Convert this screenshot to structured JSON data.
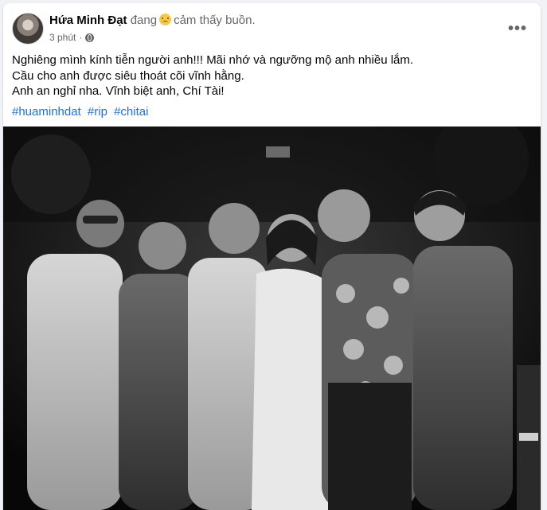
{
  "post": {
    "author": "Hứa Minh Đạt",
    "feeling_prefix": "đang",
    "feeling_emoji": "sad-face-icon",
    "feeling_text": "cảm thấy buồn.",
    "timestamp": "3 phút",
    "separator": "·",
    "privacy_icon": "globe-icon",
    "more_icon": "more-options-icon",
    "more_label": "•••",
    "lines": [
      "Nghiêng mình kính tiễn người anh!!! Mãi nhớ và ngưỡng mộ anh nhiều lắm.",
      "Cầu cho anh được siêu thoát cõi vĩnh hằng.",
      "Anh an nghỉ nha. Vĩnh biệt anh, Chí Tài!"
    ],
    "hashtags": [
      "#huaminhdat",
      "#rip",
      "#chitai"
    ],
    "photo": {
      "description_icon": "photo-image",
      "style": "black-and-white group photo"
    }
  },
  "colors": {
    "background": "#f0f2f5",
    "card": "#ffffff",
    "text": "#050505",
    "secondary": "#65676b",
    "link": "#216fdb"
  }
}
